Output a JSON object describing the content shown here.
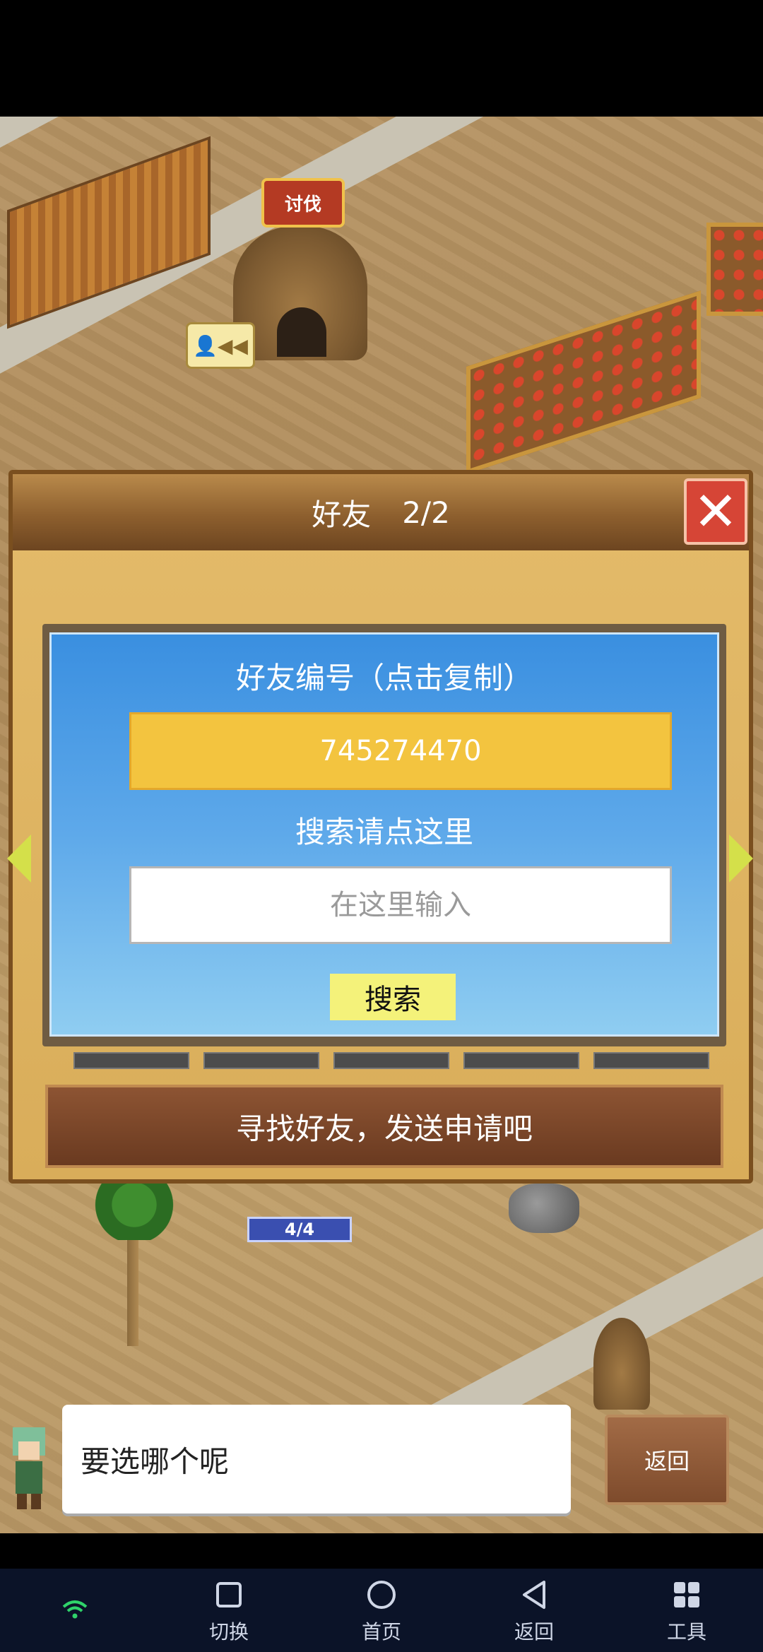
{
  "map": {
    "battle_badge": "讨伐",
    "friend_badge": "👤◀◀",
    "progress": "4/4"
  },
  "dialog": {
    "title": "好友",
    "count": "2/2",
    "close_symbol": "✕",
    "friend_id_label": "好友编号（点击复制）",
    "friend_id": "745274470",
    "search_label": "搜索请点这里",
    "search_placeholder": "在这里输入",
    "search_button": "搜索",
    "bottom_message": "寻找好友，发送申请吧"
  },
  "footer": {
    "message": "要选哪个呢",
    "back_button": "返回"
  },
  "system_nav": {
    "items": [
      {
        "label": "",
        "icon": "wifi-icon"
      },
      {
        "label": "切换",
        "icon": "square-icon"
      },
      {
        "label": "首页",
        "icon": "circle-icon"
      },
      {
        "label": "返回",
        "icon": "triangle-back-icon"
      },
      {
        "label": "工具",
        "icon": "grid-icon"
      }
    ]
  },
  "colors": {
    "dialog_bg": "#e4bb6a",
    "header": "#8d5f2e",
    "panel_blue": "#3a8fe0",
    "id_yellow": "#f3c43f",
    "close_red": "#d64536",
    "nav_bg": "#0b1328"
  }
}
